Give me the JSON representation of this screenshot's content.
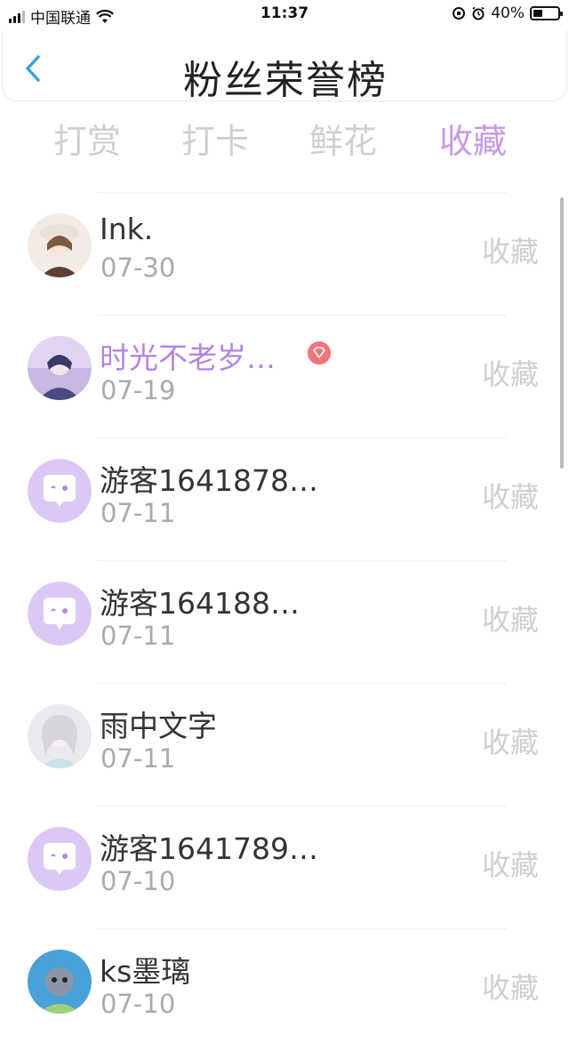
{
  "status_bar": {
    "carrier": "中国联通",
    "time": "11:37",
    "battery_percent": "40%",
    "battery_level": 0.4
  },
  "header": {
    "title": "粉丝荣誉榜",
    "back_icon": "chevron-left-icon"
  },
  "tabs": [
    {
      "label": "打赏",
      "active": false
    },
    {
      "label": "打卡",
      "active": false
    },
    {
      "label": "鲜花",
      "active": false
    },
    {
      "label": "收藏",
      "active": true
    }
  ],
  "rows": [
    {
      "name": "Ink.",
      "date": "07-30",
      "action": "收藏",
      "vip": false,
      "avatar": "photo"
    },
    {
      "name": "时光不老岁…",
      "date": "07-19",
      "action": "收藏",
      "vip": true,
      "avatar": "photo"
    },
    {
      "name": "游客1641878…",
      "date": "07-11",
      "action": "收藏",
      "vip": false,
      "avatar": "guest"
    },
    {
      "name": "游客164188…",
      "date": "07-11",
      "action": "收藏",
      "vip": false,
      "avatar": "guest"
    },
    {
      "name": "雨中文字",
      "date": "07-11",
      "action": "收藏",
      "vip": false,
      "avatar": "photo"
    },
    {
      "name": "游客1641789…",
      "date": "07-10",
      "action": "收藏",
      "vip": false,
      "avatar": "guest"
    },
    {
      "name": "ks墨璃",
      "date": "07-10",
      "action": "收藏",
      "vip": false,
      "avatar": "photo"
    }
  ],
  "colors": {
    "accent": "#c79ae6",
    "vip_name": "#b484e6",
    "guest_avatar": "#dcc8f5",
    "vip_badge": "#f2747a"
  }
}
